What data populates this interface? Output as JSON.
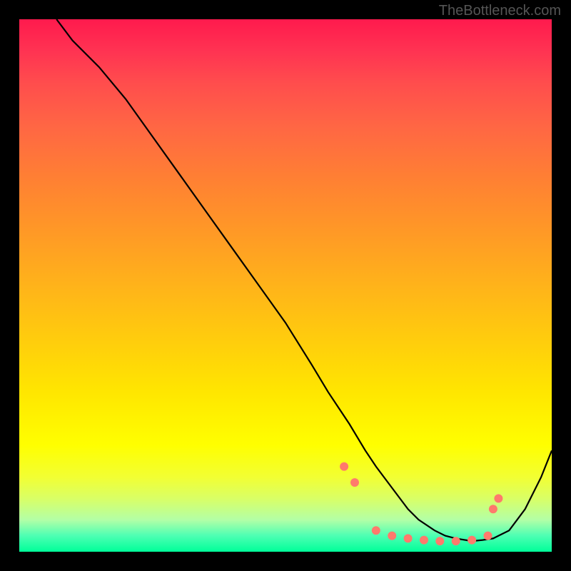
{
  "watermark": "TheBottleneck.com",
  "chart_data": {
    "type": "line",
    "title": "",
    "xlabel": "",
    "ylabel": "",
    "xlim": [
      0,
      100
    ],
    "ylim": [
      0,
      100
    ],
    "series": [
      {
        "name": "curve",
        "x": [
          7,
          10,
          15,
          20,
          25,
          30,
          35,
          40,
          45,
          50,
          55,
          58,
          60,
          62,
          65,
          67,
          70,
          73,
          75,
          78,
          80,
          82,
          85,
          87,
          89,
          90,
          92,
          95,
          98,
          100
        ],
        "y": [
          100,
          96,
          91,
          85,
          78,
          71,
          64,
          57,
          50,
          43,
          35,
          30,
          27,
          24,
          19,
          16,
          12,
          8,
          6,
          4,
          3,
          2.5,
          2,
          2.2,
          2.5,
          3,
          4,
          8,
          14,
          19
        ]
      }
    ],
    "dots": {
      "x": [
        61,
        63,
        67,
        70,
        73,
        76,
        79,
        82,
        85,
        88,
        89,
        90
      ],
      "y": [
        16,
        13,
        4,
        3,
        2.5,
        2.2,
        2,
        2,
        2.2,
        3,
        8,
        10
      ]
    },
    "gradient_stops": [
      {
        "pos": 0,
        "color": "#ff1a4d"
      },
      {
        "pos": 50,
        "color": "#ffcc0d"
      },
      {
        "pos": 80,
        "color": "#ffff00"
      },
      {
        "pos": 100,
        "color": "#00ff99"
      }
    ]
  }
}
